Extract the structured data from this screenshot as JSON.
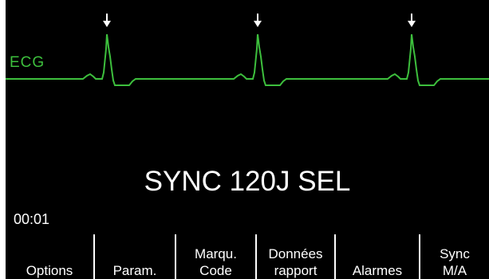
{
  "monitor": {
    "lead_label": "ECG",
    "sync_status": "SYNC 120J SEL",
    "elapsed_time": "00:01",
    "trace_color": "#3dbf3d",
    "sync_marker_icon": "down-arrow-icon"
  },
  "softkeys": [
    {
      "line1": "",
      "line2": "Options"
    },
    {
      "line1": "",
      "line2": "Param."
    },
    {
      "line1": "Marqu.",
      "line2": "Code"
    },
    {
      "line1": "Données",
      "line2": "rapport"
    },
    {
      "line1": "",
      "line2": "Alarmes"
    },
    {
      "line1": "Sync",
      "line2": "M/A"
    }
  ]
}
